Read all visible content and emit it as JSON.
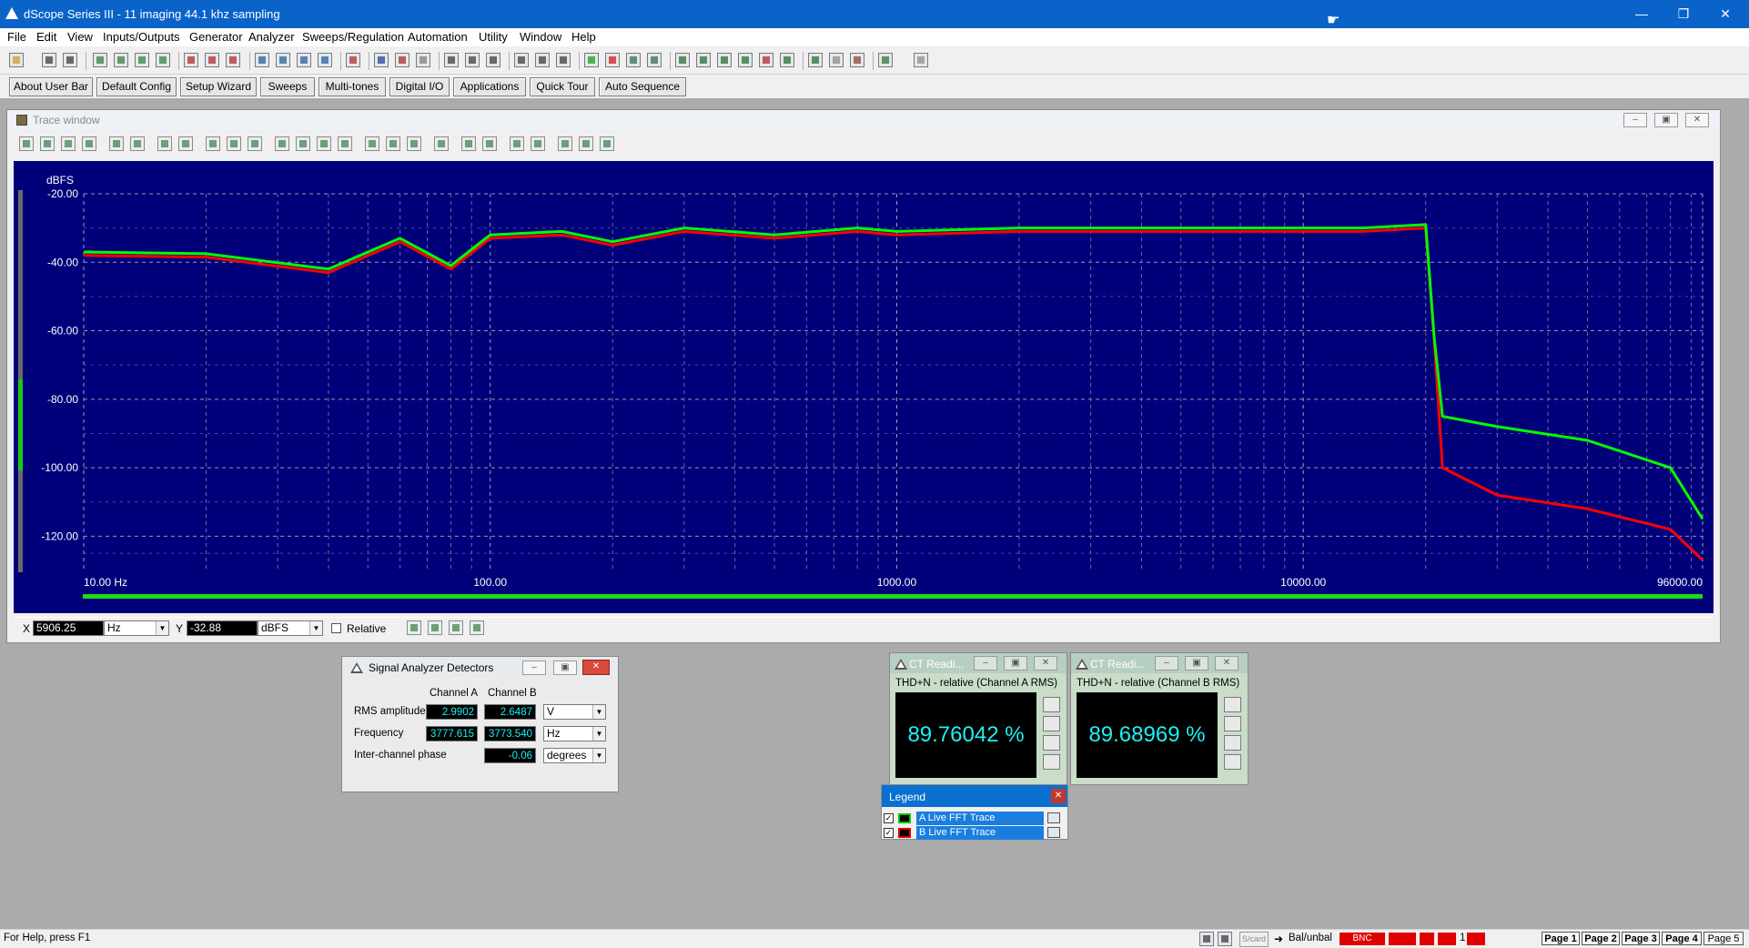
{
  "window": {
    "title": "dScope Series III - 11  imaging 44.1 khz sampling"
  },
  "menu": [
    "File",
    "Edit",
    "View",
    "Inputs/Outputs",
    "Generator",
    "Analyzer",
    "Sweeps/Regulation",
    "Automation",
    "Utility",
    "Window",
    "Help"
  ],
  "user_bar": [
    "About User Bar",
    "Default Config",
    "Setup Wizard",
    "Sweeps",
    "Multi-tones",
    "Digital I/O",
    "Applications",
    "Quick Tour",
    "Auto Sequence"
  ],
  "trace_window": {
    "title": "Trace window",
    "cursor": {
      "x_label": "X",
      "x_value": "5906.25",
      "x_unit": "Hz",
      "y_label": "Y",
      "y_value": "-32.88",
      "y_unit": "dBFS",
      "relative_label": "Relative"
    }
  },
  "chart_data": {
    "type": "line",
    "ylabel": "dBFS",
    "y_ticks": [
      "-20.00",
      "-40.00",
      "-60.00",
      "-80.00",
      "-100.00",
      "-120.00"
    ],
    "ylim": [
      -130,
      -20
    ],
    "x_ticks": [
      "10.00 Hz",
      "100.00",
      "1000.00",
      "10000.00",
      "96000.00"
    ],
    "x_scale": "log",
    "xlim": [
      10,
      96000
    ],
    "grid": true,
    "series": [
      {
        "name": "A  Live FFT Trace",
        "color": "#00ff00",
        "x": [
          10,
          20,
          40,
          60,
          80,
          100,
          150,
          200,
          300,
          500,
          800,
          1000,
          2000,
          4000,
          8000,
          14000,
          20000,
          21000,
          22000,
          30000,
          50000,
          80000,
          96000
        ],
        "y": [
          -37,
          -37.5,
          -42,
          -33,
          -41,
          -32,
          -31,
          -34,
          -30,
          -32,
          -30,
          -31,
          -30,
          -30,
          -30,
          -30,
          -29,
          -62,
          -85,
          -88,
          -92,
          -100,
          -115
        ]
      },
      {
        "name": "B  Live FFT Trace",
        "color": "#ff0000",
        "x": [
          10,
          20,
          40,
          60,
          80,
          100,
          150,
          200,
          300,
          500,
          800,
          1000,
          2000,
          4000,
          8000,
          14000,
          20000,
          21000,
          22000,
          30000,
          50000,
          80000,
          96000
        ],
        "y": [
          -38,
          -38.5,
          -43,
          -34,
          -42,
          -33,
          -32,
          -35,
          -31,
          -33,
          -31,
          -32,
          -31,
          -31,
          -31,
          -31,
          -30,
          -63,
          -100,
          -108,
          -112,
          -118,
          -127
        ]
      }
    ]
  },
  "detectors": {
    "title": "Signal Analyzer Detectors",
    "col_a": "Channel A",
    "col_b": "Channel B",
    "rows": [
      {
        "label": "RMS amplitude",
        "a": "2.9902",
        "b": "2.6487",
        "unit": "V"
      },
      {
        "label": "Frequency",
        "a": "3777.615",
        "b": "3773.540",
        "unit": "Hz"
      },
      {
        "label": "Inter-channel phase",
        "a": "",
        "b": "-0.06",
        "unit": "degrees"
      }
    ]
  },
  "ct_readers": [
    {
      "title": "CT Readi...",
      "subtitle": "THD+N - relative (Channel A RMS)",
      "value": "89.76042 %"
    },
    {
      "title": "CT Readi...",
      "subtitle": "THD+N - relative (Channel B RMS)",
      "value": "89.68969 %"
    }
  ],
  "legend": {
    "title": "Legend",
    "items": [
      {
        "label": "A  Live FFT Trace",
        "color": "#00ff00"
      },
      {
        "label": "B  Live FFT Trace",
        "color": "#ff0000"
      }
    ]
  },
  "status": {
    "help": "For Help, press F1",
    "icons_text": "S/card",
    "balance": "Bal/unbal",
    "bnc": "BNC",
    "one": "1",
    "pages": [
      "Page 1",
      "Page 2",
      "Page 3",
      "Page 4",
      "Page 5"
    ]
  }
}
